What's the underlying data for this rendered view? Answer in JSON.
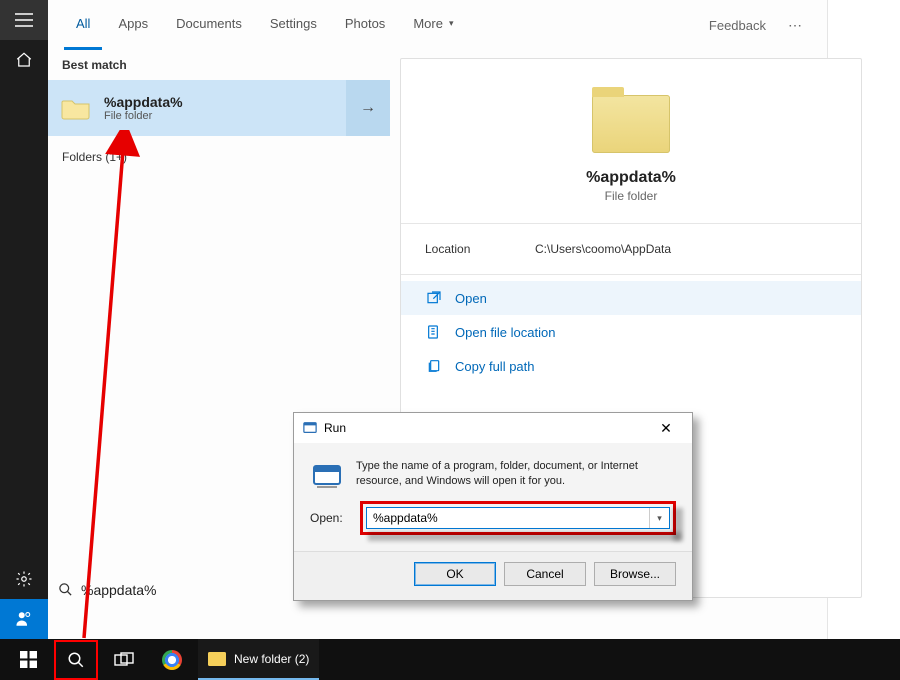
{
  "tabs": {
    "all": "All",
    "apps": "Apps",
    "documents": "Documents",
    "settings": "Settings",
    "photos": "Photos",
    "more": "More"
  },
  "header": {
    "feedback": "Feedback"
  },
  "results": {
    "best_match_header": "Best match",
    "match": {
      "title": "%appdata%",
      "subtitle": "File folder"
    },
    "folders_header": "Folders (1+)"
  },
  "preview": {
    "title": "%appdata%",
    "subtitle": "File folder",
    "location_label": "Location",
    "location_value": "C:\\Users\\coomo\\AppData",
    "actions": {
      "open": "Open",
      "open_location": "Open file location",
      "copy_path": "Copy full path"
    }
  },
  "search": {
    "query": "%appdata%"
  },
  "run_dialog": {
    "title": "Run",
    "body": "Type the name of a program, folder, document, or Internet resource, and Windows will open it for you.",
    "open_label": "Open:",
    "open_value": "%appdata%",
    "ok": "OK",
    "cancel": "Cancel",
    "browse": "Browse..."
  },
  "taskbar": {
    "task_title": "New folder (2)"
  }
}
